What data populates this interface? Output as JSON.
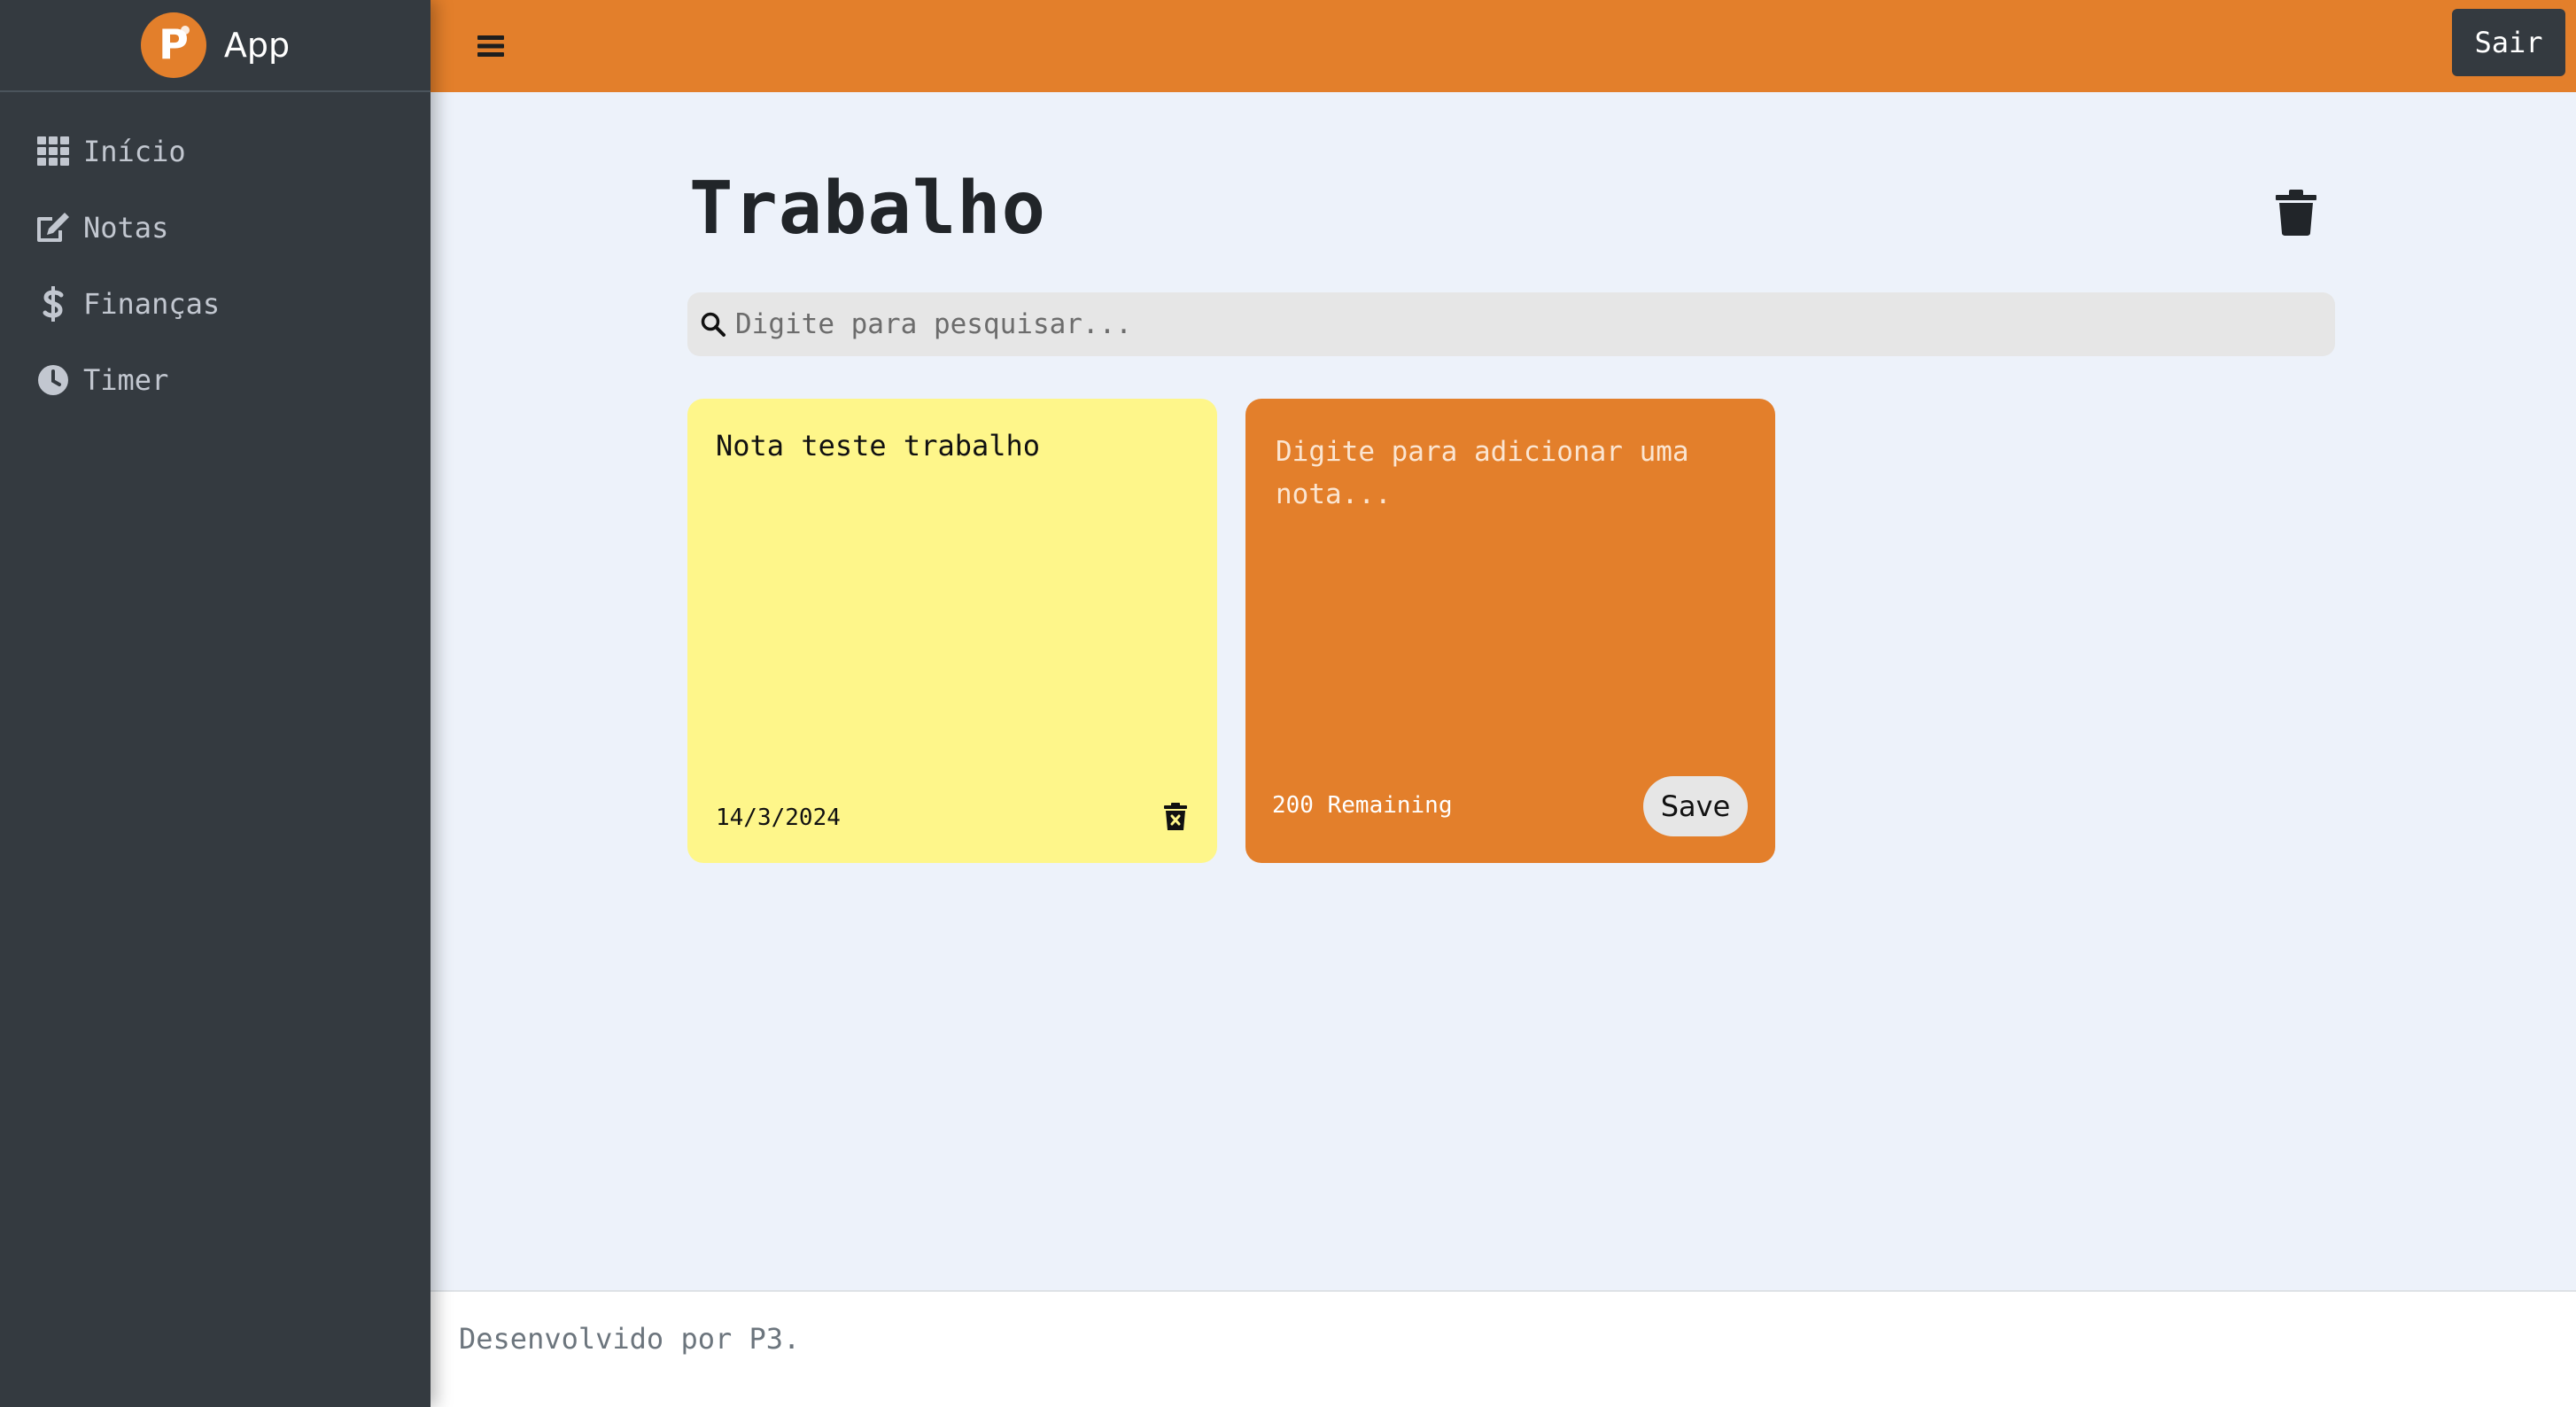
{
  "brand": {
    "name": "App",
    "logo_letter": "P"
  },
  "sidebar": {
    "items": [
      {
        "label": "Início",
        "icon": "grid-icon"
      },
      {
        "label": "Notas",
        "icon": "edit-icon"
      },
      {
        "label": "Finanças",
        "icon": "dollar-icon"
      },
      {
        "label": "Timer",
        "icon": "clock-icon"
      }
    ]
  },
  "header": {
    "logout_label": "Sair"
  },
  "main": {
    "title": "Trabalho",
    "search": {
      "placeholder": "Digite para pesquisar...",
      "value": ""
    },
    "notes": [
      {
        "text": "Nota teste trabalho",
        "date": "14/3/2024"
      }
    ],
    "new_note": {
      "placeholder": "Digite para adicionar uma nota...",
      "remaining": "200 Remaining",
      "save_label": "Save"
    }
  },
  "footer": {
    "text": "Desenvolvido por P3."
  },
  "colors": {
    "accent": "#e37f2b",
    "sidebar": "#343a40",
    "note_yellow": "#fef68a",
    "background": "#edf2fa"
  }
}
